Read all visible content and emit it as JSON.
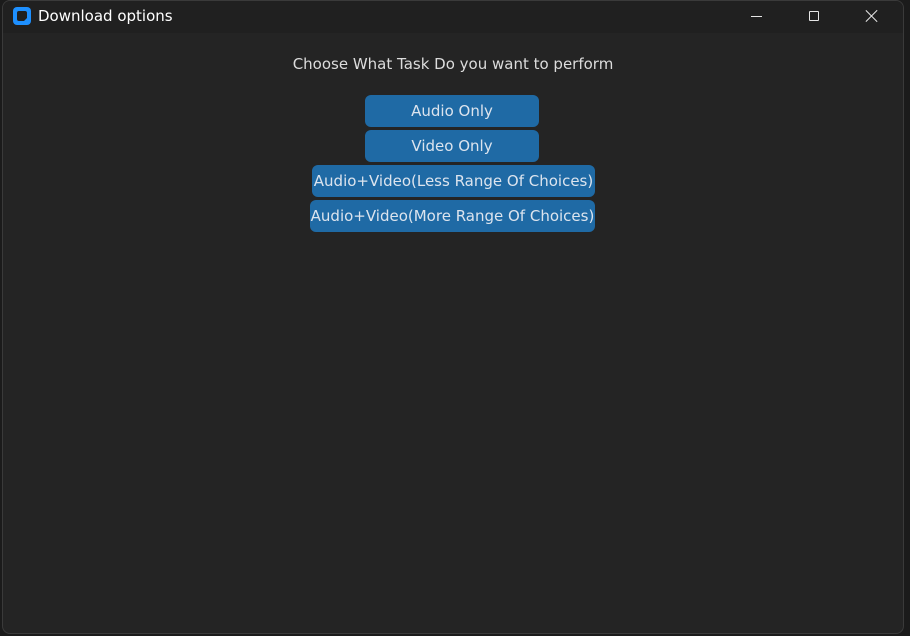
{
  "window": {
    "title": "Download options",
    "controls": {
      "minimize": "minimize-icon",
      "maximize": "maximize-icon",
      "close": "close-icon"
    }
  },
  "main": {
    "prompt": "Choose What Task Do you want to perform",
    "buttons": [
      {
        "label": "Audio Only"
      },
      {
        "label": "Video Only"
      },
      {
        "label": "Audio+Video(Less Range Of Choices)"
      },
      {
        "label": "Audio+Video(More Range Of Choices)"
      }
    ]
  },
  "colors": {
    "accent": "#1f6aa5",
    "background": "#242424",
    "titlebar": "#202020"
  }
}
